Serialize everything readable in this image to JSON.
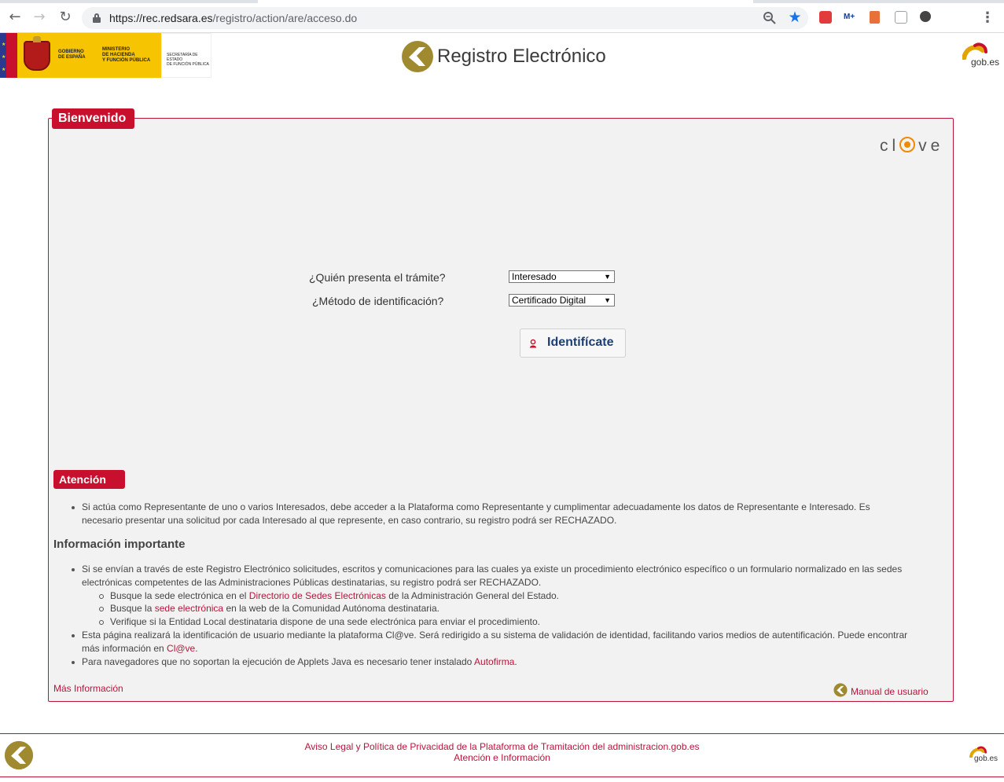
{
  "browser": {
    "url_host": "https://rec.redsara.es",
    "url_path": "/registro/action/are/acceso.do",
    "colors": {
      "star": "#1a73e8",
      "toolbar_icons": "#5f6368"
    }
  },
  "header": {
    "gov_text_1": "GOBIERNO\nDE ESPAÑA",
    "gov_text_2": "MINISTERIO\nDE HACIENDA\nY FUNCIÓN PÚBLICA",
    "gov_text_3": "SECRETARÍA DE ESTADO\nDE FUNCIÓN PÚBLICA",
    "title": "Registro Electrónico",
    "gobes": "gob.es"
  },
  "panel": {
    "welcome_badge": "Bienvenido",
    "clave_logo": "cl ve",
    "form": {
      "who_label": "¿Quién presenta el trámite?",
      "who_value": "Interesado",
      "method_label": "¿Método de identificación?",
      "method_value": "Certificado Digital",
      "submit_label": "Identifícate"
    },
    "attention_badge": "Atención",
    "attention_text": "Si actúa como Representante de uno o varios Interesados, debe acceder a la Plataforma como Representante y cumplimentar adecuadamente los datos de Representante e Interesado. Es necesario presentar una solicitud por cada Interesado al que represente, en caso contrario, su registro podrá ser RECHAZADO.",
    "info_title": "Información importante",
    "info": {
      "item1": "Si se envían a través de este Registro Electrónico solicitudes, escritos y comunicaciones para las cuales ya existe un procedimiento electrónico específico o un formulario normalizado en las sedes electrónicas competentes de las Administraciones Públicas destinatarias, su registro podrá ser RECHAZADO.",
      "sub1_pre": "Busque la sede electrónica en el ",
      "sub1_link": "Directorio de Sedes Electrónicas",
      "sub1_post": " de la Administración General del Estado.",
      "sub2_pre": "Busque la ",
      "sub2_link": "sede electrónica",
      "sub2_post": " en la web de la Comunidad Autónoma destinataria.",
      "sub3": "Verifique si la Entidad Local destinataria dispone de una sede electrónica para enviar el procedimiento.",
      "item2_pre": "Esta página realizará la identificación de usuario mediante la plataforma Cl@ve. Será redirigido a su sistema de validación de identidad, facilitando varios medios de autentificación. Puede encontrar más información en ",
      "item2_link": "Cl@ve",
      "item2_post": ".",
      "item3_pre": "Para navegadores que no soportan la ejecución de Applets Java es necesario tener instalado ",
      "item3_link": "Autofirma",
      "item3_post": "."
    },
    "more_info_link": "Más Información",
    "manual_link": "Manual de usuario"
  },
  "footer": {
    "legal_link": "Aviso Legal y Política de Privacidad de la Plataforma de Tramitación del administracion.gob.es",
    "attention_link": "Atención e Información",
    "gobes": "gob.es"
  },
  "colors": {
    "accent": "#c8102e",
    "link": "#b5173b",
    "brand_gold": "#a08a30",
    "panel_bg": "#f2f2f2"
  }
}
